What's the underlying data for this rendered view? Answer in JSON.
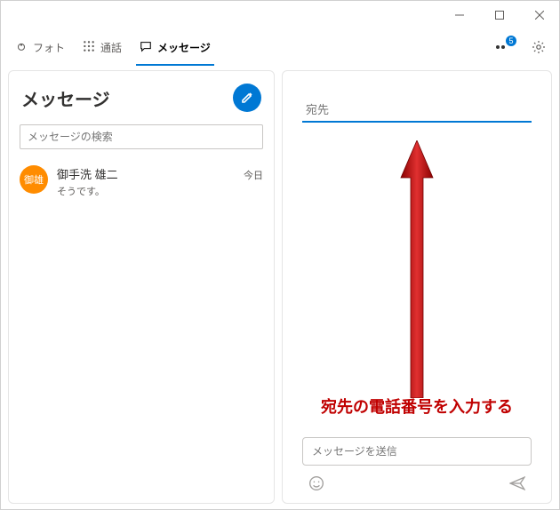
{
  "titlebar": {
    "app_name": ""
  },
  "tabs": {
    "photo": "フォト",
    "call": "通話",
    "message": "メッセージ"
  },
  "header": {
    "notification_count": "5"
  },
  "sidebar": {
    "title": "メッセージ",
    "search_placeholder": "メッセージの検索"
  },
  "conversations": [
    {
      "avatar_initials": "御雄",
      "name": "御手洗 雄二",
      "preview": "そうです。",
      "time": "今日"
    }
  ],
  "compose": {
    "recipient_placeholder": "宛先",
    "message_placeholder": "メッセージを送信"
  },
  "annotation": {
    "text": "宛先の電話番号を入力する"
  }
}
